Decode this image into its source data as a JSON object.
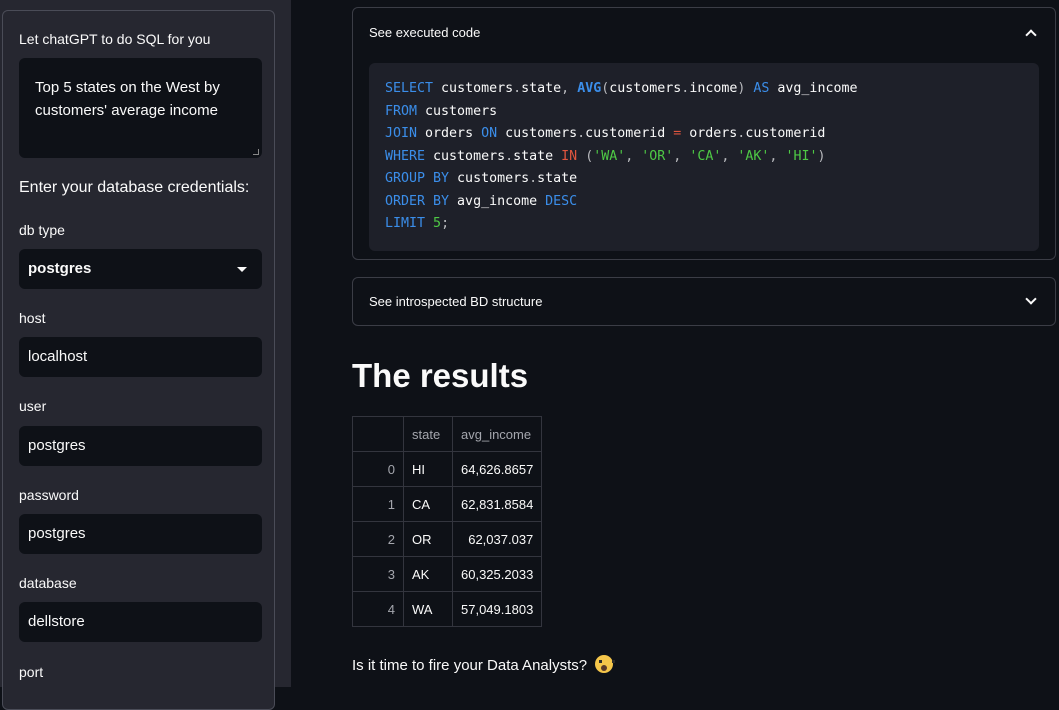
{
  "sidebar": {
    "prompt_label": "Let chatGPT to do SQL for you",
    "prompt_value": "Top 5 states on the West by customers' average income",
    "credentials_heading": "Enter your database credentials:",
    "db_type_label": "db type",
    "db_type_value": "postgres",
    "host_label": "host",
    "host_value": "localhost",
    "user_label": "user",
    "user_value": "postgres",
    "password_label": "password",
    "password_value": "postgres",
    "database_label": "database",
    "database_value": "dellstore",
    "port_label": "port"
  },
  "main": {
    "executed_code_title": "See executed code",
    "code": {
      "l1": {
        "k1": "SELECT",
        "t1": " customers",
        "p1": ".",
        "t2": "state",
        "p2": ",",
        "t3": " ",
        "k2": "AVG",
        "p3": "(",
        "t4": "customers",
        "p4": ".",
        "t5": "income",
        "p5": ")",
        "t6": " ",
        "k3": "AS",
        "t7": " avg_income"
      },
      "l2": {
        "k1": "FROM",
        "t1": " customers"
      },
      "l3": {
        "k1": "JOIN",
        "t1": " orders ",
        "k2": "ON",
        "t2": " customers",
        "p1": ".",
        "t3": "customerid ",
        "o1": "=",
        "t4": " orders",
        "p2": ".",
        "t5": "customerid"
      },
      "l4": {
        "k1": "WHERE",
        "t1": " customers",
        "p1": ".",
        "t2": "state ",
        "k2": "IN",
        "t3": " ",
        "p2": "(",
        "s1": "'WA'",
        "p3": ",",
        "t4": " ",
        "s2": "'OR'",
        "p4": ",",
        "t5": " ",
        "s3": "'CA'",
        "p5": ",",
        "t6": " ",
        "s4": "'AK'",
        "p6": ",",
        "t7": " ",
        "s5": "'HI'",
        "p7": ")"
      },
      "l5": {
        "k1": "GROUP BY",
        "t1": " customers",
        "p1": ".",
        "t2": "state"
      },
      "l6": {
        "k1": "ORDER BY",
        "t1": " avg_income ",
        "k2": "DESC"
      },
      "l7": {
        "k1": "LIMIT",
        "t1": " ",
        "n1": "5",
        "p1": ";"
      }
    },
    "introspected_title": "See introspected BD structure",
    "results_title": "The results",
    "table": {
      "columns": [
        "",
        "state",
        "avg_income"
      ],
      "rows": [
        {
          "index": "0",
          "state": "HI",
          "avg_income": "64,626.8657"
        },
        {
          "index": "1",
          "state": "CA",
          "avg_income": "62,831.8584"
        },
        {
          "index": "2",
          "state": "OR",
          "avg_income": "62,037.037"
        },
        {
          "index": "3",
          "state": "AK",
          "avg_income": "60,325.2033"
        },
        {
          "index": "4",
          "state": "WA",
          "avg_income": "57,049.1803"
        }
      ]
    },
    "footer_question": "Is it time to fire your Data Analysts?",
    "footer_emoji_icon": "screaming-face-emoji"
  }
}
